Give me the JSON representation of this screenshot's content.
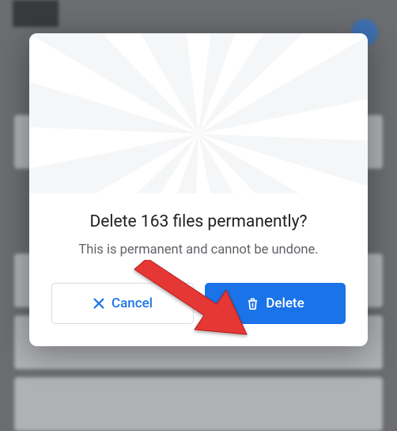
{
  "dialog": {
    "title": "Delete 163 files permanently?",
    "message": "This is permanent and cannot be undone.",
    "cancel_label": "Cancel",
    "delete_label": "Delete"
  },
  "annotation": {
    "arrow_color": "#e53935"
  }
}
